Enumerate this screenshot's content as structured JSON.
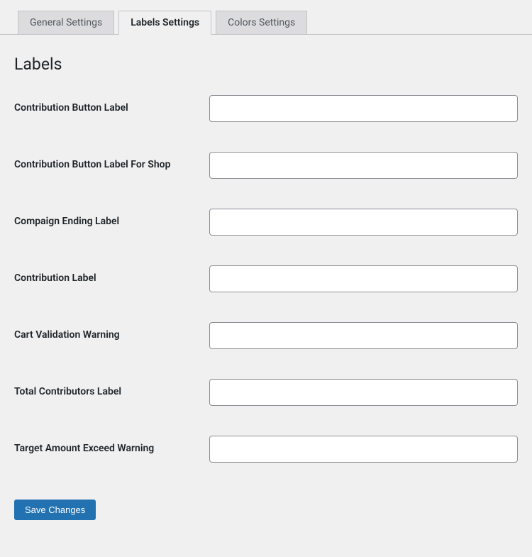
{
  "tabs": {
    "general": "General Settings",
    "labels": "Labels Settings",
    "colors": "Colors Settings",
    "active": "labels"
  },
  "section": {
    "heading": "Labels"
  },
  "fields": {
    "contribution_button": {
      "label": "Contribution Button Label",
      "value": ""
    },
    "contribution_button_shop": {
      "label": "Contribution Button Label For Shop",
      "value": ""
    },
    "campaign_ending": {
      "label": "Compaign Ending Label",
      "value": ""
    },
    "contribution": {
      "label": "Contribution Label",
      "value": ""
    },
    "cart_validation": {
      "label": "Cart Validation Warning",
      "value": ""
    },
    "total_contributors": {
      "label": "Total Contributors Label",
      "value": ""
    },
    "target_exceed": {
      "label": "Target Amount Exceed Warning",
      "value": ""
    }
  },
  "actions": {
    "save": "Save Changes"
  }
}
